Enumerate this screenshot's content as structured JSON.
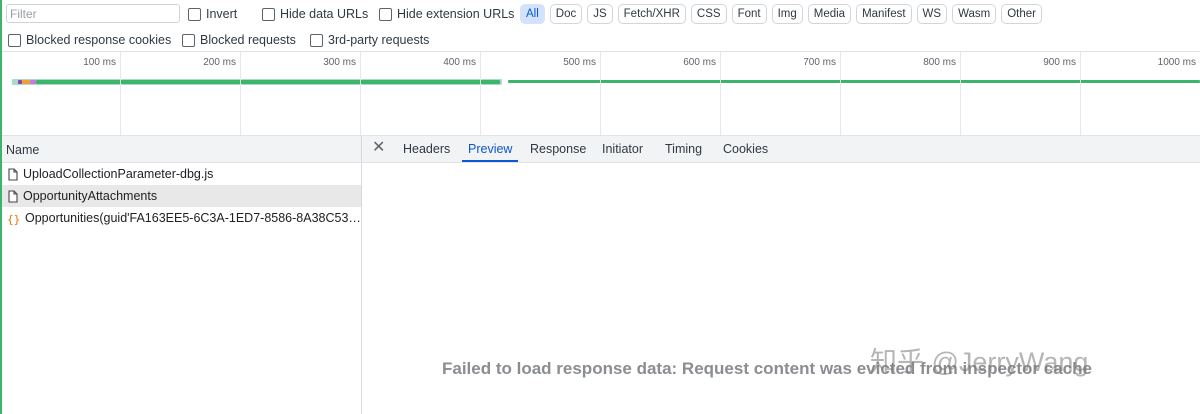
{
  "toolbar": {
    "filter_placeholder": "Filter",
    "invert_label": "Invert",
    "hide_data_urls_label": "Hide data URLs",
    "hide_extension_urls_label": "Hide extension URLs",
    "types": [
      "All",
      "Doc",
      "JS",
      "Fetch/XHR",
      "CSS",
      "Font",
      "Img",
      "Media",
      "Manifest",
      "WS",
      "Wasm",
      "Other"
    ],
    "active_type": "All"
  },
  "filters_row2": {
    "blocked_response_cookies": "Blocked response cookies",
    "blocked_requests": "Blocked requests",
    "third_party_requests": "3rd-party requests"
  },
  "overview": {
    "tick_labels": [
      "100 ms",
      "200 ms",
      "300 ms",
      "400 ms",
      "500 ms",
      "600 ms",
      "700 ms",
      "800 ms",
      "900 ms",
      "1000 ms"
    ]
  },
  "requests": {
    "column_header": "Name",
    "rows": [
      {
        "name": "UploadCollectionParameter-dbg.js",
        "icon": "document-icon",
        "selected": false
      },
      {
        "name": "OpportunityAttachments",
        "icon": "document-icon",
        "selected": true
      },
      {
        "name": "Opportunities(guid'FA163EE5-6C3A-1ED7-8586-8A38C532...",
        "icon": "json-braces-icon",
        "selected": false
      }
    ]
  },
  "detail": {
    "tabs": [
      "Headers",
      "Preview",
      "Response",
      "Initiator",
      "Timing",
      "Cookies"
    ],
    "active_tab": "Preview",
    "message": "Failed to load response data: Request content was evicted from inspector cache"
  },
  "watermark": "知乎 @JerryWang",
  "colors": {
    "accent": "#0b57d0",
    "active_chip_bg": "#d3e3fd",
    "waterfall_green": "#3bb56a",
    "edge_green": "#3bb56a"
  }
}
